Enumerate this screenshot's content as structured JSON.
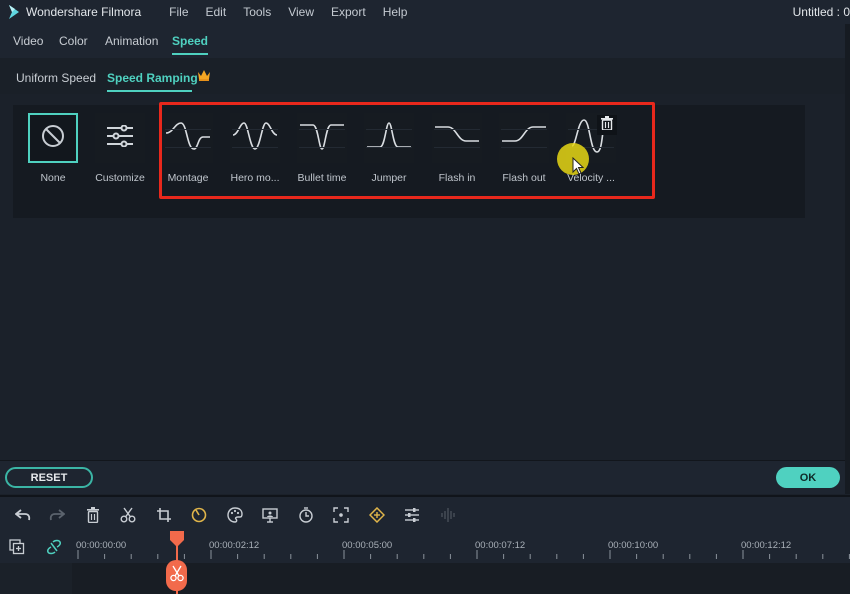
{
  "app": {
    "title": "Wondershare Filmora",
    "document_title": "Untitled : 0",
    "menu": [
      "File",
      "Edit",
      "Tools",
      "View",
      "Export",
      "Help"
    ]
  },
  "tabs": [
    {
      "label": "Video",
      "active": false
    },
    {
      "label": "Color",
      "active": false
    },
    {
      "label": "Animation",
      "active": false
    },
    {
      "label": "Speed",
      "active": true
    }
  ],
  "subtabs": [
    {
      "label": "Uniform Speed",
      "active": false
    },
    {
      "label": "Speed Ramping",
      "active": true,
      "badge": "crown-icon"
    }
  ],
  "presets": [
    {
      "label": "None",
      "icon": "none-icon",
      "selected": true
    },
    {
      "label": "Customize",
      "icon": "sliders-icon",
      "selected": false
    },
    {
      "label": "Montage",
      "icon": "montage-curve-icon",
      "selected": false
    },
    {
      "label": "Hero mo...",
      "icon": "hero-moment-curve-icon",
      "selected": false
    },
    {
      "label": "Bullet time",
      "icon": "bullet-time-curve-icon",
      "selected": false
    },
    {
      "label": "Jumper",
      "icon": "jumper-curve-icon",
      "selected": false
    },
    {
      "label": "Flash in",
      "icon": "flash-in-curve-icon",
      "selected": false
    },
    {
      "label": "Flash out",
      "icon": "flash-out-curve-icon",
      "selected": false
    },
    {
      "label": "Velocity ...",
      "icon": "velocity-curve-icon",
      "selected": false,
      "has_delete": true
    }
  ],
  "buttons": {
    "reset": "RESET",
    "ok": "OK"
  },
  "toolbar": [
    "undo-icon",
    "redo-icon",
    "delete-icon",
    "cut-icon",
    "crop-icon",
    "speed-icon",
    "color-icon",
    "presentation-icon",
    "duration-icon",
    "focus-icon",
    "keyframe-icon",
    "adjust-icon",
    "audio-icon"
  ],
  "timeline": {
    "ruler_labels": [
      "00:00:00:00",
      "00:00:02:12",
      "00:00:05:00",
      "00:00:07:12",
      "00:00:10:00",
      "00:00:12:12"
    ]
  },
  "colors": {
    "accent": "#4fd1c0",
    "highlight_box": "#e8281c",
    "playhead": "#f26a4b",
    "cursor_highlight": "#e6d714",
    "background": "#1b212a"
  }
}
